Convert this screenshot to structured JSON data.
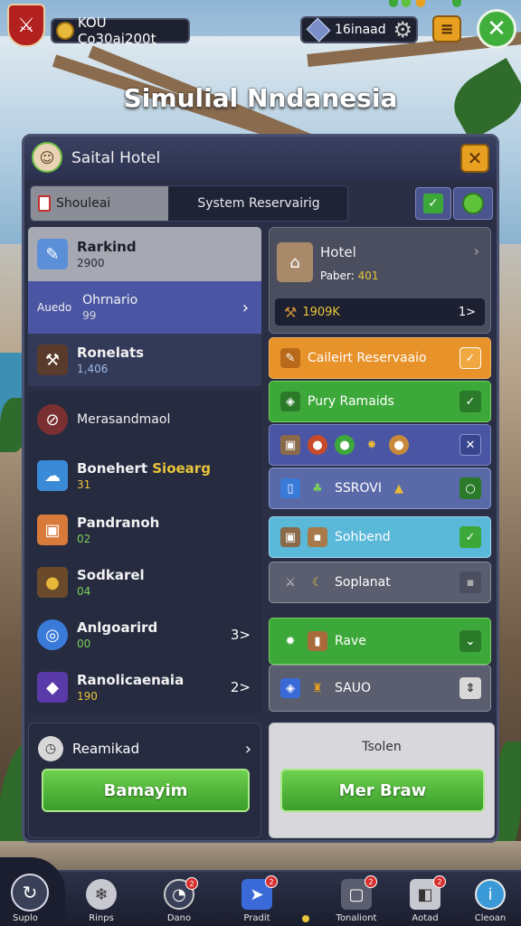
{
  "header": {
    "currency_text": "KOU Co30ai200t",
    "gem_text": "16inaad",
    "scene_title": "Simulial Nndanesia"
  },
  "panel": {
    "title": "Saital Hotel",
    "tabs": [
      "Shouleai",
      "System Reservairig"
    ]
  },
  "left_items": [
    {
      "name": "Rarkind",
      "value": "2900"
    },
    {
      "prefix": "Auedo",
      "name": "Ohrnario",
      "value": "99"
    },
    {
      "name": "Ronelats",
      "value": "1,406"
    },
    {
      "name": "Merasandmaol",
      "value": ""
    },
    {
      "name": "Bonehert",
      "name2": "Sioearg",
      "value": "31"
    },
    {
      "name": "Pandranoh",
      "value": "02"
    },
    {
      "name": "Sodkarel",
      "value": "04"
    },
    {
      "name": "Anlgoarird",
      "value": "00",
      "count": "3>"
    },
    {
      "name": "Ranolicaenaia",
      "value": "190",
      "count": "2>"
    },
    {
      "name": "Reamikad",
      "value": ""
    }
  ],
  "right_items": {
    "hotel": {
      "name": "Hotel",
      "sub_label": "Paber:",
      "sub_value": "401",
      "amount": "1909K",
      "count": "1>"
    },
    "rows": [
      {
        "label": "Caileirt Reservaaio"
      },
      {
        "label": "Pury Ramaids"
      },
      {
        "label": ""
      },
      {
        "label": "SSROVI"
      },
      {
        "label": "Sohbend"
      },
      {
        "label": "Soplanat"
      },
      {
        "label": "Rave"
      },
      {
        "label": "SAUO"
      }
    ],
    "tesolen": "Tsolen"
  },
  "buttons": {
    "left": "Bamayim",
    "right": "Mer Braw"
  },
  "nav": [
    {
      "label": "Suplo"
    },
    {
      "label": "Rinps",
      "badge": ""
    },
    {
      "label": "Dano",
      "badge": "2"
    },
    {
      "label": "Pradit",
      "badge": "2"
    },
    {
      "label": "Tonaliont",
      "badge": "2"
    },
    {
      "label": "Aotad",
      "badge": "2"
    },
    {
      "label": "Cleoan",
      "badge": ""
    }
  ],
  "colors": {
    "panel": "#2a2f45",
    "accent_green": "#3da83a",
    "accent_orange": "#e8a020",
    "highlight_blue": "#4a56a4"
  }
}
